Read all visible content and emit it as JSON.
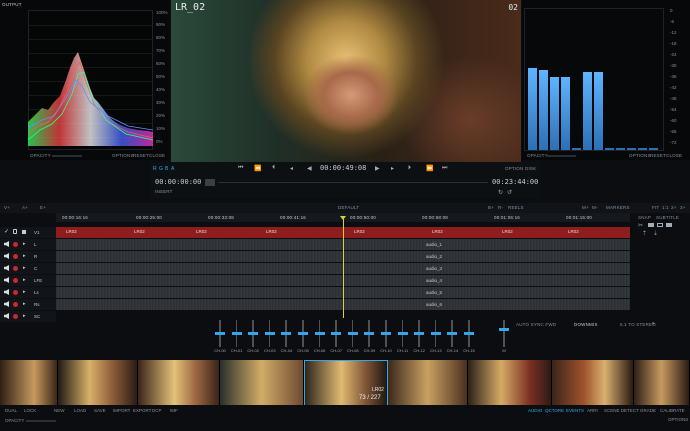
{
  "scope": {
    "title": "OUTPUT",
    "percent_labels": [
      "100%",
      "90%",
      "80%",
      "70%",
      "60%",
      "50%",
      "40%",
      "30%",
      "20%",
      "10%",
      "0%"
    ],
    "footer_left": "OPACITY",
    "footer_buttons": [
      "OPTIONS",
      "RESET",
      "CLOSE"
    ]
  },
  "viewer": {
    "clip_name": "LR_02",
    "clip_number": "02"
  },
  "meter": {
    "db_labels": [
      "0",
      "-6",
      "-12",
      "-18",
      "-24",
      "-30",
      "-36",
      "-42",
      "-48",
      "-54",
      "-60",
      "-66",
      "-72"
    ],
    "levels": [
      0.58,
      0.57,
      0.52,
      0.52,
      0.0,
      0.55,
      0.55,
      0.0,
      0.0,
      0.0,
      0.0,
      0.0
    ],
    "footer_left": "OPACITY",
    "footer_buttons": [
      "OPTIONS",
      "RESET",
      "CLOSE"
    ]
  },
  "transport": {
    "channels": [
      "R",
      "G",
      "B",
      "A"
    ],
    "current_tc": "00:00:49:08",
    "in_tc": "00:00:00:00",
    "out_tc": "00:23:44:00",
    "left_label": "INSERT",
    "right_label": "DISK",
    "right_prefix": "OPTION"
  },
  "timeline": {
    "header_left": [
      "V+",
      "A+",
      "E+"
    ],
    "header_center": "DEFAULT",
    "header_right": [
      "B+",
      "R-",
      "REELS",
      "M+",
      "M-",
      "MARKERS",
      "FIT",
      "1:1",
      "2+",
      "3+"
    ],
    "ruler_ticks": [
      "00:00:16:16",
      "00:00:25:00",
      "00:00:33:08",
      "00:00:41:16",
      "00:00:50:00",
      "00:00:58:08",
      "00:01:06:16",
      "00:01:15:00"
    ],
    "video_track": {
      "name": "V1",
      "segments": [
        "LR02",
        "LR02",
        "LR02",
        "LR02",
        "LR02",
        "LR02",
        "LR02",
        "LR02"
      ]
    },
    "audio_tracks": [
      {
        "name": "L",
        "label": "audio_1"
      },
      {
        "name": "R",
        "label": "audio_2"
      },
      {
        "name": "C",
        "label": "audio_3"
      },
      {
        "name": "LFE",
        "label": "audio_4"
      },
      {
        "name": "Ls",
        "label": "audio_5"
      },
      {
        "name": "Rs",
        "label": "audio_6"
      },
      {
        "name": "SC",
        "label": ""
      }
    ],
    "right_tools": [
      "SNAP",
      "SUBTITLE"
    ]
  },
  "mixer": {
    "faders": [
      {
        "name": "CH-00",
        "level": 0.5
      },
      {
        "name": "CH-01",
        "level": 0.5
      },
      {
        "name": "CH-02",
        "level": 0.5
      },
      {
        "name": "CH-03",
        "level": 0.5
      },
      {
        "name": "CH-04",
        "level": 0.5
      },
      {
        "name": "CH-05",
        "level": 0.5
      },
      {
        "name": "CH-06",
        "level": 0.5
      },
      {
        "name": "CH-07",
        "level": 0.5
      },
      {
        "name": "CH-08",
        "level": 0.5
      },
      {
        "name": "CH-09",
        "level": 0.5
      },
      {
        "name": "CH-10",
        "level": 0.5
      },
      {
        "name": "CH-11",
        "level": 0.5
      },
      {
        "name": "CH-12",
        "level": 0.5
      },
      {
        "name": "CH-13",
        "level": 0.5
      },
      {
        "name": "CH-14",
        "level": 0.5
      },
      {
        "name": "CH-15",
        "level": 0.5
      }
    ],
    "master_name": "M",
    "auto_sync": "AUTO SYNC FWD",
    "downmix_label": "DOWNMIX",
    "downmix_value": "5.1 TO STEREO"
  },
  "filmstrip": {
    "selected_name": "LR02",
    "selected_count": "73 / 227"
  },
  "bottom": {
    "left": [
      "DUAL",
      "LOCK",
      "NEW",
      "LOAD",
      "SAVE",
      "IMPORT",
      "EXPORT",
      "DCP",
      "IMF"
    ],
    "right_active": [
      "AUDIO",
      "QCTORE",
      "EVENTS"
    ],
    "right_rest": [
      "ARRI",
      "SCENE DETECT",
      "GRADE",
      "CALIBRATE"
    ],
    "opacity": "OPACITY",
    "options": "OPTIONS"
  },
  "colors": {
    "accent": "#35a7e8",
    "video_track": "#8e1d1d",
    "record": "#cc2a2a"
  }
}
